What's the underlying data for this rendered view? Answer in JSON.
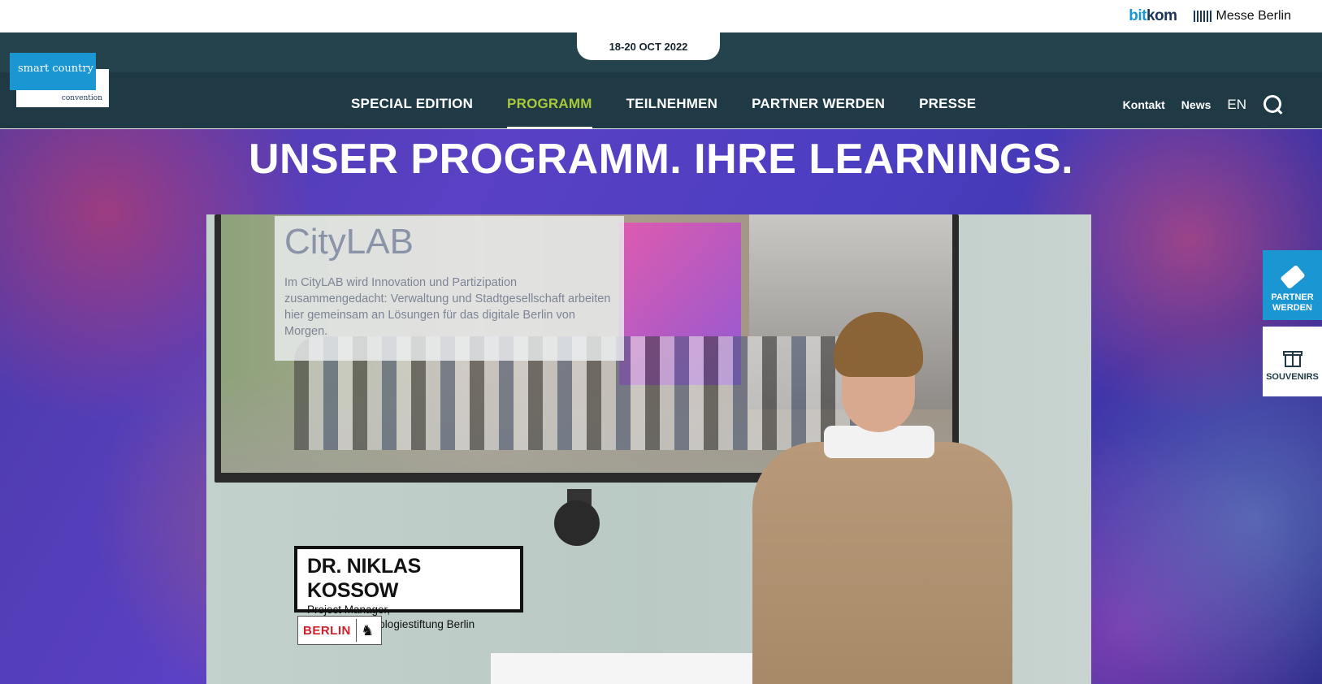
{
  "topbar": {
    "bitkom_a": "bit",
    "bitkom_b": "kom",
    "messe": "Messe Berlin"
  },
  "header": {
    "date": "18-20 OCT 2022",
    "logo_line1": "smart country",
    "logo_line2": "convention",
    "nav": [
      {
        "label": "SPECIAL EDITION"
      },
      {
        "label": "PROGRAMM",
        "active": true
      },
      {
        "label": "TEILNEHMEN"
      },
      {
        "label": "PARTNER WERDEN"
      },
      {
        "label": "PRESSE"
      }
    ],
    "util": {
      "kontakt": "Kontakt",
      "news": "News",
      "lang": "EN"
    }
  },
  "hero": {
    "title": "UNSER PROGRAMM. IHRE LEARNINGS."
  },
  "video": {
    "screen_title": "CityLAB",
    "screen_text": "Im CityLAB wird Innovation und Partizipation zusammengedacht: Verwaltung und Stadtgesellschaft arbeiten hier gemeinsam an Lösungen für das digitale Berlin von Morgen.",
    "speaker_name": "DR. NIKLAS KOSSOW",
    "speaker_role": "Project Manager,",
    "speaker_org": "CityLAB Technologiestiftung Berlin",
    "badge": "BERLIN"
  },
  "side": {
    "partner_line1": "PARTNER",
    "partner_line2": "WERDEN",
    "souvenirs": "SOUVENIRS"
  },
  "colors": {
    "accent_green": "#a9c93a",
    "brand_blue": "#1a96d2",
    "header_dark": "#1f3a44"
  }
}
